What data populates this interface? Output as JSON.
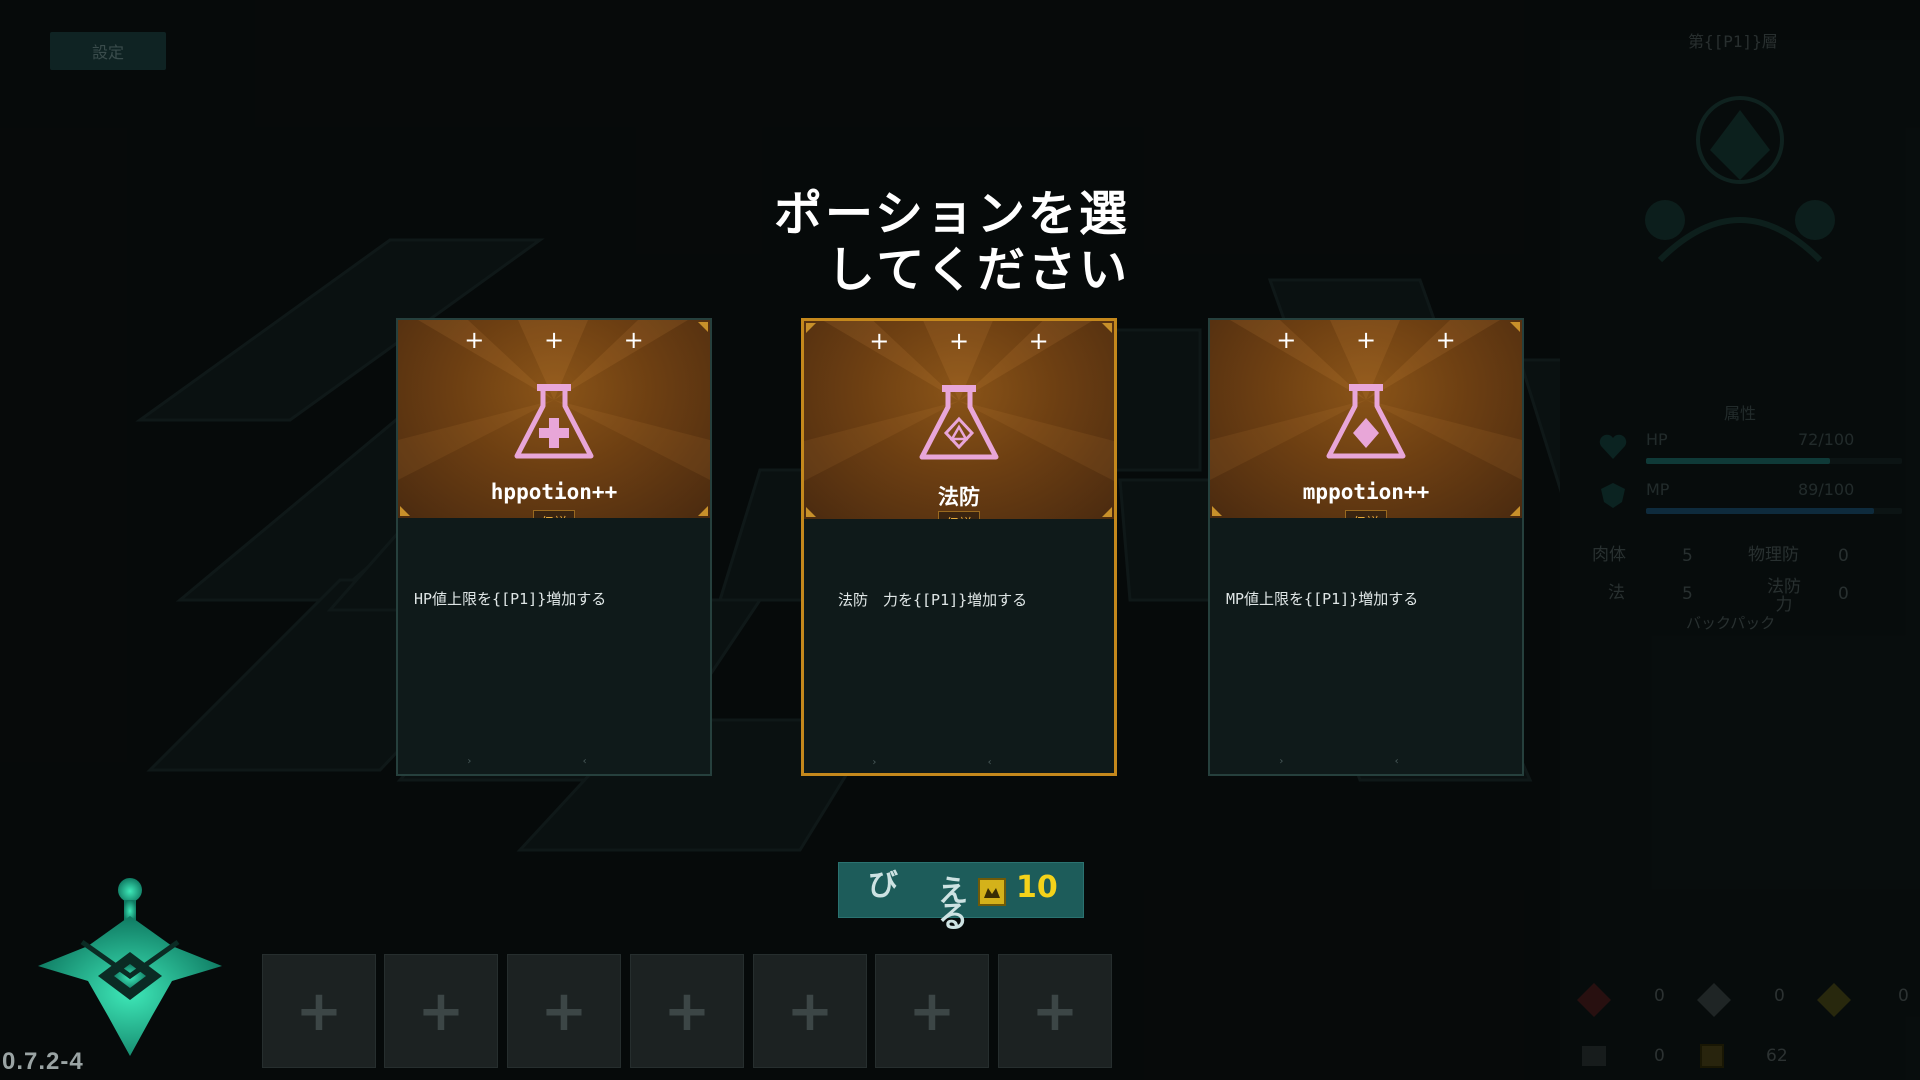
{
  "settings_label": "設定",
  "floor_label": "第{[P1]}層",
  "version": "0.7.2-4",
  "title_line1": "ポーションを選",
  "title_line2": "してください",
  "cards": [
    {
      "stars": "+ + +",
      "name": "hppotion++",
      "rarity": "伝説",
      "description": "HP値上限を{[P1]}増加する",
      "icon": "flask-plus-icon",
      "foot": "› ‹"
    },
    {
      "stars": "+ + +",
      "name": "法防",
      "rarity": "伝説",
      "description": "法防　力を{[P1]}増加する",
      "icon": "flask-triangle-icon",
      "foot": "› ‹"
    },
    {
      "stars": "+ + +",
      "name": "mppotion++",
      "rarity": "伝説",
      "description": "MP値上限を{[P1]}増加する",
      "icon": "flask-diamond-icon",
      "foot": "› ‹"
    }
  ],
  "reroll": {
    "chars": [
      "び",
      "え",
      "る"
    ],
    "cost": "10",
    "coin_icon": "coin-icon"
  },
  "inventory_slots": [
    "+",
    "+",
    "+",
    "+",
    "+",
    "+",
    "+"
  ],
  "right_panel": {
    "section_title": "属性",
    "hp_label": "HP",
    "hp_value": "72/100",
    "hp_fraction": 0.72,
    "mp_label": "MP",
    "mp_value": "89/100",
    "mp_fraction": 0.89,
    "stats": [
      {
        "label": "肉体",
        "value": "5"
      },
      {
        "label": "物理防",
        "value": "0"
      },
      {
        "label": "法",
        "value": "5"
      },
      {
        "label": "法防力",
        "value": "0"
      }
    ],
    "bag_label": "バックパック",
    "resources": [
      "0",
      "0",
      "0",
      "0",
      "62"
    ]
  },
  "colors": {
    "accent": "#c4881c",
    "teal": "#1d5c5a",
    "gold": "#f4d21a"
  }
}
